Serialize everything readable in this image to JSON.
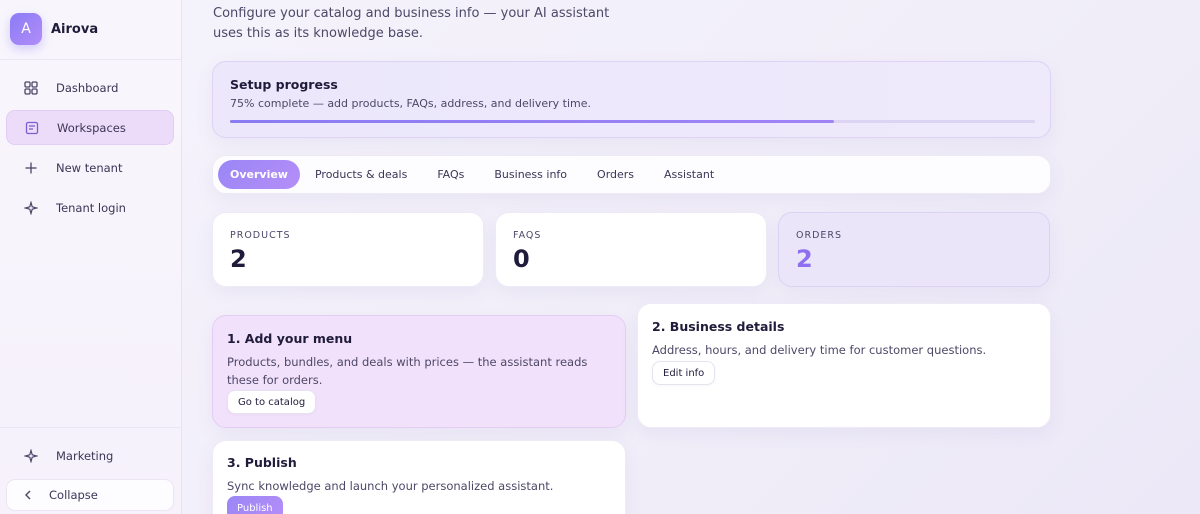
{
  "brand": {
    "initial": "A",
    "name": "Airova"
  },
  "sidebar": {
    "items": [
      {
        "label": "Dashboard",
        "icon": "grid-icon"
      },
      {
        "label": "Workspaces",
        "icon": "workspace-icon"
      },
      {
        "label": "New tenant",
        "icon": "plus-icon"
      },
      {
        "label": "Tenant login",
        "icon": "sparkle-icon"
      }
    ],
    "marketing": {
      "label": "Marketing",
      "icon": "sparkle-icon"
    },
    "collapse": {
      "label": "Collapse",
      "icon": "chevron-left-icon"
    }
  },
  "intro": "Configure your catalog and business info — your AI assistant uses this as its knowledge base.",
  "progress": {
    "title": "Setup progress",
    "subtitle": "75% complete — add products, FAQs, address, and delivery time.",
    "percent": 75
  },
  "tabs": [
    {
      "label": "Overview",
      "active": true
    },
    {
      "label": "Products & deals"
    },
    {
      "label": "FAQs"
    },
    {
      "label": "Business info"
    },
    {
      "label": "Orders"
    },
    {
      "label": "Assistant"
    }
  ],
  "stats": [
    {
      "label": "PRODUCTS",
      "value": "2"
    },
    {
      "label": "FAQS",
      "value": "0"
    },
    {
      "label": "ORDERS",
      "value": "2"
    }
  ],
  "steps": {
    "menu": {
      "title": "1. Add your menu",
      "description": "Products, bundles, and deals with prices — the assistant reads these for orders.",
      "button": "Go to catalog"
    },
    "business": {
      "title": "2. Business details",
      "description": "Address, hours, and delivery time for customer questions.",
      "button": "Edit info"
    },
    "publish": {
      "title": "3. Publish",
      "description": "Sync knowledge and launch your personalized assistant.",
      "button": "Publish"
    }
  },
  "colors": {
    "accent": "#9a86f6",
    "accent_light": "#ecdcf9",
    "text": "#1f1b3a"
  }
}
